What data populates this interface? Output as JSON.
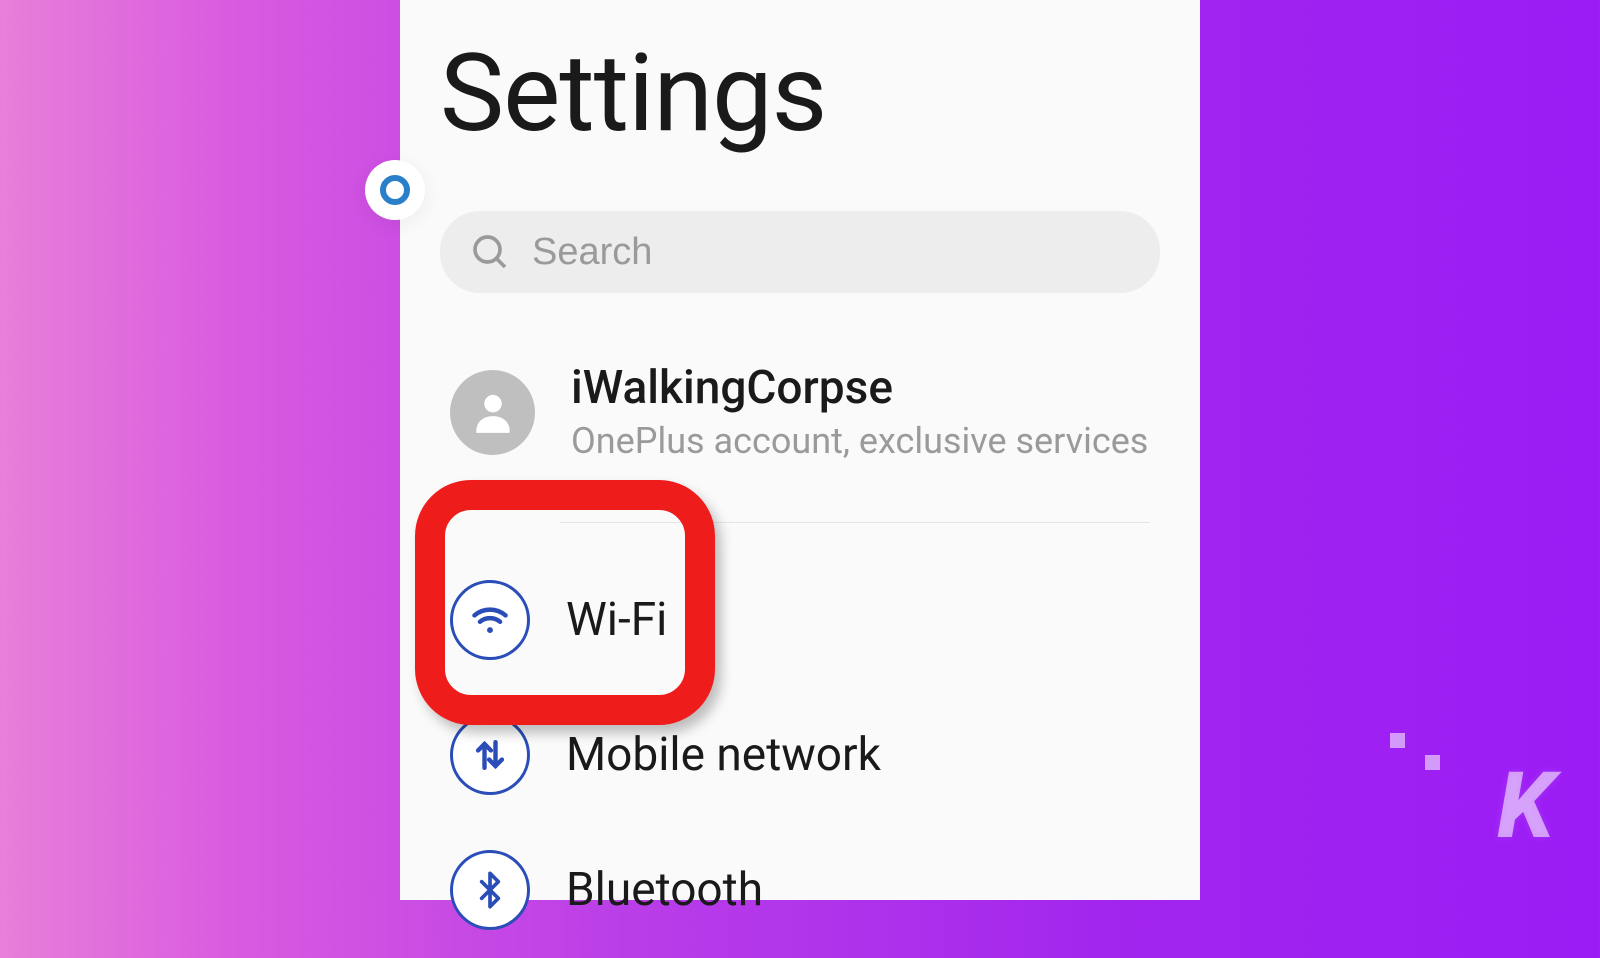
{
  "header": {
    "title": "Settings"
  },
  "search": {
    "placeholder": "Search"
  },
  "account": {
    "name": "iWalkingCorpse",
    "subtitle": "OnePlus account, exclusive services"
  },
  "items": [
    {
      "label": "Wi-Fi",
      "icon": "wifi-icon"
    },
    {
      "label": "Mobile network",
      "icon": "mobile-network-icon"
    },
    {
      "label": "Bluetooth",
      "icon": "bluetooth-icon"
    }
  ],
  "watermark": "K"
}
